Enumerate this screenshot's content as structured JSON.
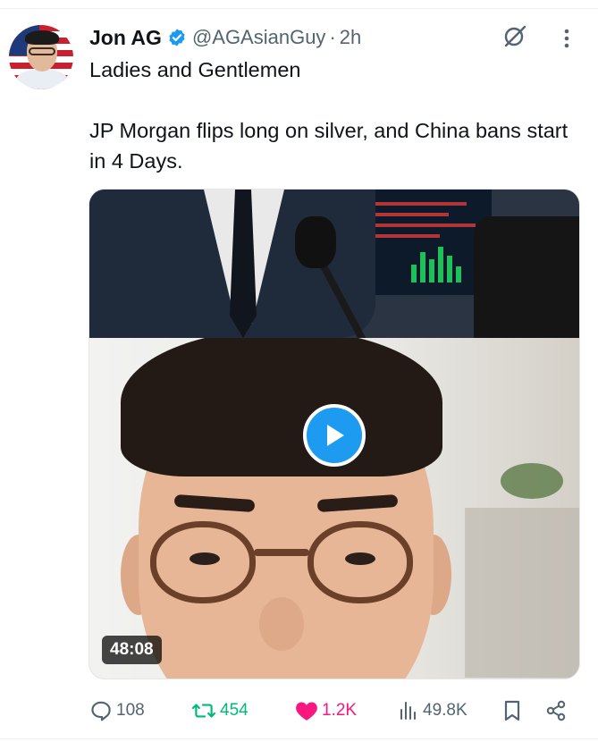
{
  "post": {
    "author_name": "Jon AG",
    "handle": "@AGAsianGuy",
    "separator": "·",
    "timestamp": "2h",
    "text_line_1": "Ladies and Gentlemen",
    "text_line_2": "JP Morgan flips long on silver, and China bans start in 4 Days."
  },
  "media": {
    "type": "video",
    "duration": "48:08",
    "play_icon": "play-icon"
  },
  "actions": {
    "replies": "108",
    "reposts": "454",
    "likes": "1.2K",
    "views": "49.8K"
  },
  "icons": {
    "verified": "verified-badge-icon",
    "grok": "grok-icon",
    "more": "more-icon",
    "reply": "reply-icon",
    "repost": "repost-icon",
    "like": "heart-icon",
    "views": "views-icon",
    "bookmark": "bookmark-icon",
    "share": "share-icon"
  },
  "colors": {
    "accent": "#1d9bf0",
    "repost": "#00ba7c",
    "like": "#f91880",
    "muted": "#536471",
    "text": "#0f1419"
  }
}
